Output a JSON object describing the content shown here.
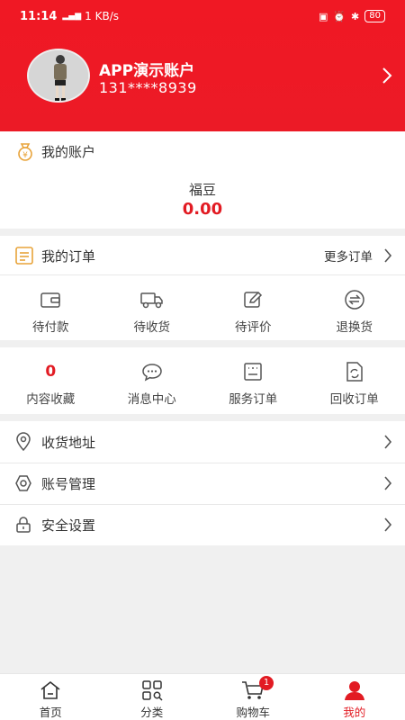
{
  "status_bar": {
    "time": "11:14",
    "net_speed": "1 KB/s",
    "battery": "80"
  },
  "profile": {
    "name": "APP演示账户",
    "phone": "131****8939"
  },
  "account": {
    "title": "我的账户",
    "balance_label": "福豆",
    "balance_value": "0.00"
  },
  "orders": {
    "title": "我的订单",
    "more_label": "更多订单",
    "items": [
      {
        "label": "待付款",
        "icon": "wallet-icon"
      },
      {
        "label": "待收货",
        "icon": "delivery-truck-icon"
      },
      {
        "label": "待评价",
        "icon": "edit-icon"
      },
      {
        "label": "退换货",
        "icon": "exchange-icon"
      }
    ]
  },
  "services": {
    "items": [
      {
        "label": "内容收藏",
        "count": "0"
      },
      {
        "label": "消息中心",
        "icon": "chat-icon"
      },
      {
        "label": "服务订单",
        "icon": "service-order-icon"
      },
      {
        "label": "回收订单",
        "icon": "recycle-order-icon"
      }
    ]
  },
  "menu": {
    "items": [
      {
        "label": "收货地址",
        "icon": "location-icon"
      },
      {
        "label": "账号管理",
        "icon": "gear-icon"
      },
      {
        "label": "安全设置",
        "icon": "lock-icon"
      }
    ]
  },
  "tabbar": {
    "items": [
      {
        "label": "首页",
        "icon": "home-icon"
      },
      {
        "label": "分类",
        "icon": "category-icon"
      },
      {
        "label": "购物车",
        "icon": "cart-icon",
        "badge": "1"
      },
      {
        "label": "我的",
        "icon": "user-icon",
        "active": true
      }
    ]
  },
  "colors": {
    "brand": "#e21b23",
    "header": "#ef1a25"
  }
}
